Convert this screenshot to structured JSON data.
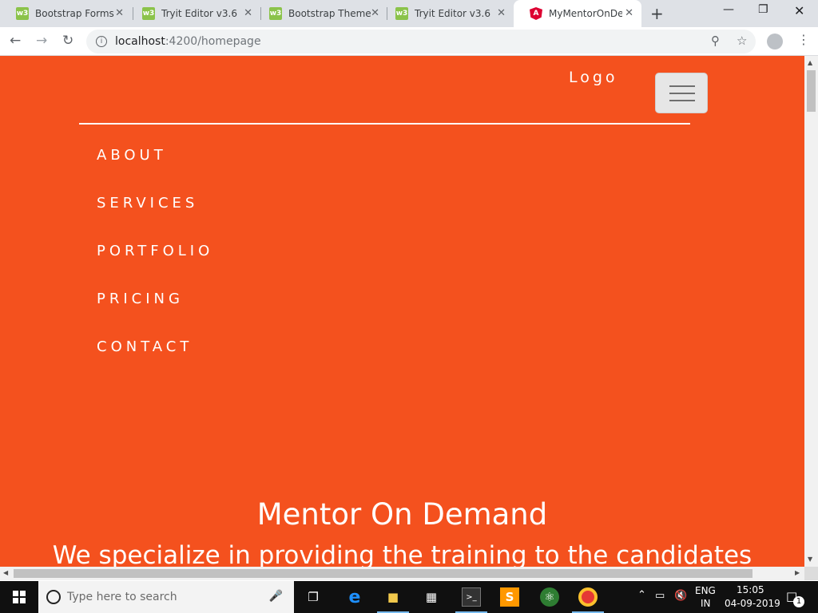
{
  "browser": {
    "tabs": [
      {
        "title": "Bootstrap Forms",
        "favicon": "w3-icon",
        "active": false
      },
      {
        "title": "Tryit Editor v3.6",
        "favicon": "w3-icon",
        "active": false
      },
      {
        "title": "Bootstrap Theme",
        "favicon": "w3-icon",
        "active": false
      },
      {
        "title": "Tryit Editor v3.6",
        "favicon": "w3-icon",
        "active": false
      },
      {
        "title": "MyMentorOnDem",
        "favicon": "angular-icon",
        "active": true
      }
    ],
    "new_tab_label": "+",
    "close_glyph": "✕",
    "url_host": "localhost",
    "url_path": ":4200/homepage"
  },
  "page": {
    "background_color": "#f4511e",
    "logo": "Logo",
    "nav_links": [
      "ABOUT",
      "SERVICES",
      "PORTFOLIO",
      "PRICING",
      "CONTACT"
    ],
    "hero_title": "Mentor On Demand",
    "hero_subtitle": "We specialize in providing the training to the candidates"
  },
  "taskbar": {
    "search_placeholder": "Type here to search",
    "language": "ENG",
    "region": "IN",
    "time": "15:05",
    "date": "04-09-2019",
    "notification_count": "1"
  }
}
